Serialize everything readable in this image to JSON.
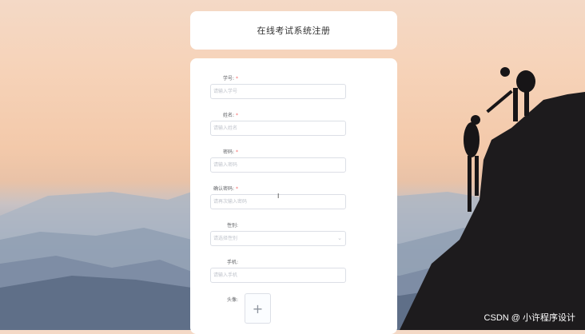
{
  "header": {
    "title": "在线考试系统注册"
  },
  "form": {
    "fields": [
      {
        "label": "学号:",
        "required": "*",
        "placeholder": "请输入学号"
      },
      {
        "label": "姓名:",
        "required": "*",
        "placeholder": "请输入姓名"
      },
      {
        "label": "密码:",
        "required": "*",
        "placeholder": "请输入密码"
      },
      {
        "label": "确认密码:",
        "required": "*",
        "placeholder": "请再次输入密码"
      },
      {
        "label": "性别:",
        "required": "",
        "placeholder": "请选择性别"
      },
      {
        "label": "手机:",
        "required": "",
        "placeholder": "请输入手机"
      },
      {
        "label": "头像:",
        "required": ""
      }
    ],
    "upload_icon": "+"
  },
  "watermark": "CSDN @ 小许程序设计",
  "cursor": "I",
  "chevron": "⌄"
}
